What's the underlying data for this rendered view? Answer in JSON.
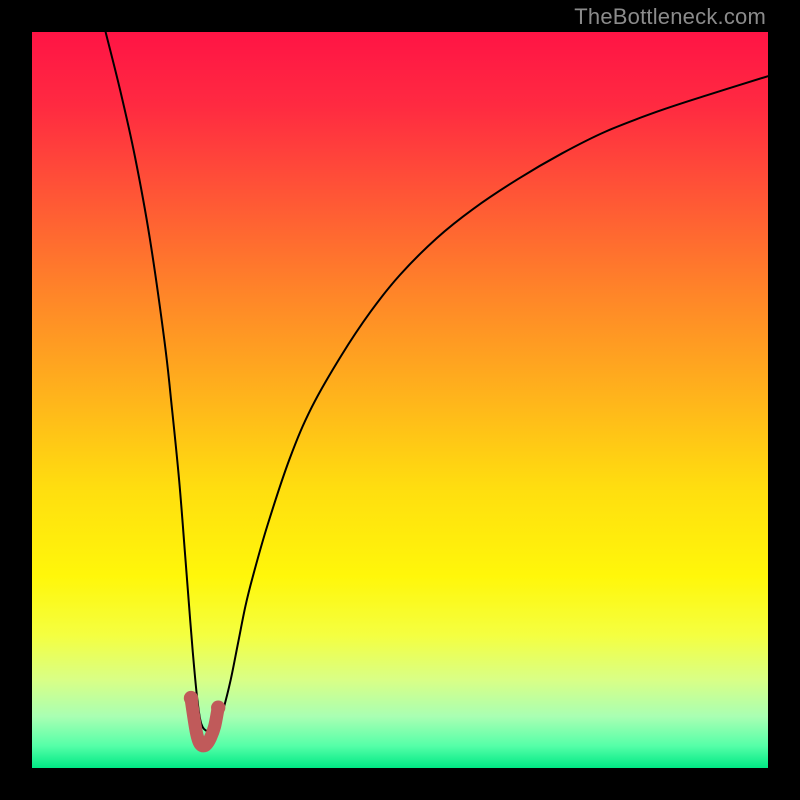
{
  "watermark_text": "TheBottleneck.com",
  "chart_data": {
    "type": "line",
    "title": "",
    "xlabel": "",
    "ylabel": "",
    "xlim": [
      0,
      100
    ],
    "ylim": [
      0,
      100
    ],
    "grid": false,
    "legend": false,
    "gradient_stops": [
      {
        "pos": 0.0,
        "color": "#ff1445"
      },
      {
        "pos": 0.1,
        "color": "#ff2a41"
      },
      {
        "pos": 0.22,
        "color": "#ff5536"
      },
      {
        "pos": 0.35,
        "color": "#ff8329"
      },
      {
        "pos": 0.5,
        "color": "#ffb51b"
      },
      {
        "pos": 0.62,
        "color": "#ffde0f"
      },
      {
        "pos": 0.74,
        "color": "#fff70a"
      },
      {
        "pos": 0.82,
        "color": "#f4ff41"
      },
      {
        "pos": 0.88,
        "color": "#d9ff86"
      },
      {
        "pos": 0.93,
        "color": "#a9ffb3"
      },
      {
        "pos": 0.97,
        "color": "#55ffa8"
      },
      {
        "pos": 1.0,
        "color": "#00e884"
      }
    ],
    "series": [
      {
        "name": "main-curve",
        "color": "#000000",
        "width": 2,
        "x": [
          10,
          12,
          14,
          16,
          18,
          19,
          20,
          20.8,
          21.5,
          22,
          22.5,
          23,
          23.8,
          24.5,
          25.3,
          26,
          27,
          28,
          29,
          30,
          32,
          35,
          38,
          42,
          46,
          50,
          55,
          60,
          66,
          72,
          78,
          85,
          92,
          100
        ],
        "y": [
          100,
          92,
          83,
          72,
          58,
          49,
          39,
          29,
          20,
          14,
          9,
          6,
          5,
          5.2,
          6,
          8,
          12,
          17,
          22,
          26,
          33,
          42,
          49,
          56,
          62,
          67,
          72,
          76,
          80,
          83.5,
          86.5,
          89.2,
          91.5,
          94
        ]
      },
      {
        "name": "bottom-marker",
        "color": "#c05a5a",
        "width": 13,
        "x": [
          21.6,
          22.0,
          22.3,
          22.6,
          22.9,
          23.3,
          23.7,
          24.2,
          24.8,
          25.3
        ],
        "y": [
          9.5,
          6.8,
          5.0,
          3.8,
          3.2,
          3.0,
          3.2,
          4.0,
          5.6,
          8.2
        ]
      }
    ]
  }
}
